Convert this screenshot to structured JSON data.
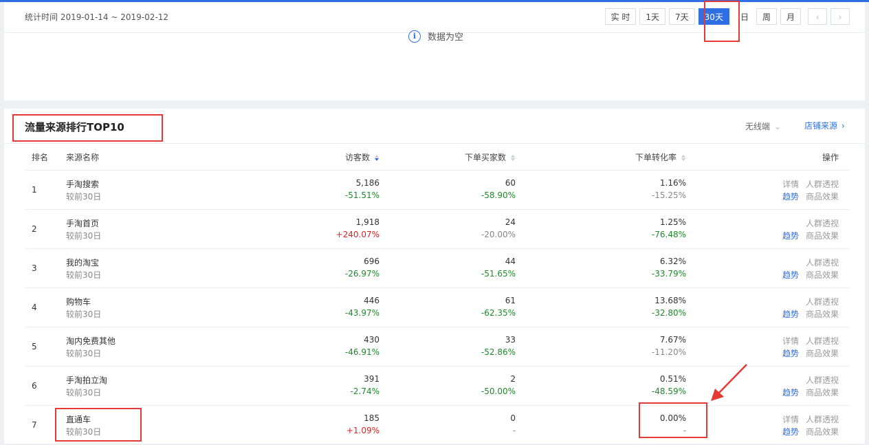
{
  "header": {
    "stat_period": "统计时间 2019-01-14 ~ 2019-02-12",
    "periods": [
      "实 时",
      "1天",
      "7天",
      "30天",
      "日",
      "周",
      "月"
    ],
    "active_period": "30天",
    "prev_icon": "chevron-left-icon",
    "next_icon": "chevron-right-icon",
    "prev_glyph": "‹",
    "next_glyph": "›"
  },
  "empty_state": {
    "icon": "info-icon",
    "icon_glyph": "i",
    "text": "数据为空"
  },
  "section": {
    "title": "流量来源排行TOP10",
    "device": "无线端",
    "device_chevron": "⌄",
    "shop_source_link": "店铺来源",
    "shop_source_chevron": "›"
  },
  "table": {
    "headers": {
      "rank": "排名",
      "name": "来源名称",
      "visitors": "访客数",
      "buyers": "下单买家数",
      "conversion": "下单转化率",
      "ops": "操作"
    },
    "rows": [
      {
        "rank": "1",
        "name": "手淘搜索",
        "compare": "较前30日",
        "visitors": "5,186",
        "visitors_change": "-51.51%",
        "buyers": "60",
        "buyers_change": "-58.90%",
        "conv": "1.16%",
        "conv_change": "-15.25%",
        "op1": "详情",
        "op2": "人群透视",
        "op3": "趋势",
        "op4": "商品效果"
      },
      {
        "rank": "2",
        "name": "手淘首页",
        "compare": "较前30日",
        "visitors": "1,918",
        "visitors_change": "+240.07%",
        "buyers": "24",
        "buyers_change": "-20.00%",
        "conv": "1.25%",
        "conv_change": "-76.48%",
        "op1": "",
        "op2": "人群透视",
        "op3": "趋势",
        "op4": "商品效果"
      },
      {
        "rank": "3",
        "name": "我的淘宝",
        "compare": "较前30日",
        "visitors": "696",
        "visitors_change": "-26.97%",
        "buyers": "44",
        "buyers_change": "-51.65%",
        "conv": "6.32%",
        "conv_change": "-33.79%",
        "op1": "",
        "op2": "人群透视",
        "op3": "趋势",
        "op4": "商品效果"
      },
      {
        "rank": "4",
        "name": "购物车",
        "compare": "较前30日",
        "visitors": "446",
        "visitors_change": "-43.97%",
        "buyers": "61",
        "buyers_change": "-62.35%",
        "conv": "13.68%",
        "conv_change": "-32.80%",
        "op1": "",
        "op2": "人群透视",
        "op3": "趋势",
        "op4": "商品效果"
      },
      {
        "rank": "5",
        "name": "淘内免费其他",
        "compare": "较前30日",
        "visitors": "430",
        "visitors_change": "-46.91%",
        "buyers": "33",
        "buyers_change": "-52.86%",
        "conv": "7.67%",
        "conv_change": "-11.20%",
        "op1": "详情",
        "op2": "人群透视",
        "op3": "趋势",
        "op4": "商品效果"
      },
      {
        "rank": "6",
        "name": "手淘拍立淘",
        "compare": "较前30日",
        "visitors": "391",
        "visitors_change": "-2.74%",
        "buyers": "2",
        "buyers_change": "-50.00%",
        "conv": "0.51%",
        "conv_change": "-48.59%",
        "op1": "",
        "op2": "人群透视",
        "op3": "趋势",
        "op4": "商品效果"
      },
      {
        "rank": "7",
        "name": "直通车",
        "compare": "较前30日",
        "visitors": "185",
        "visitors_change": "+1.09%",
        "buyers": "0",
        "buyers_change": "-",
        "conv": "0.00%",
        "conv_change": "-",
        "op1": "详情",
        "op2": "人群透视",
        "op3": "趋势",
        "op4": "商品效果"
      }
    ]
  },
  "colors": {
    "accent": "#2f6fe4",
    "positive": "#e02020",
    "negative": "#1d8a2a",
    "annotation": "#e53935"
  }
}
